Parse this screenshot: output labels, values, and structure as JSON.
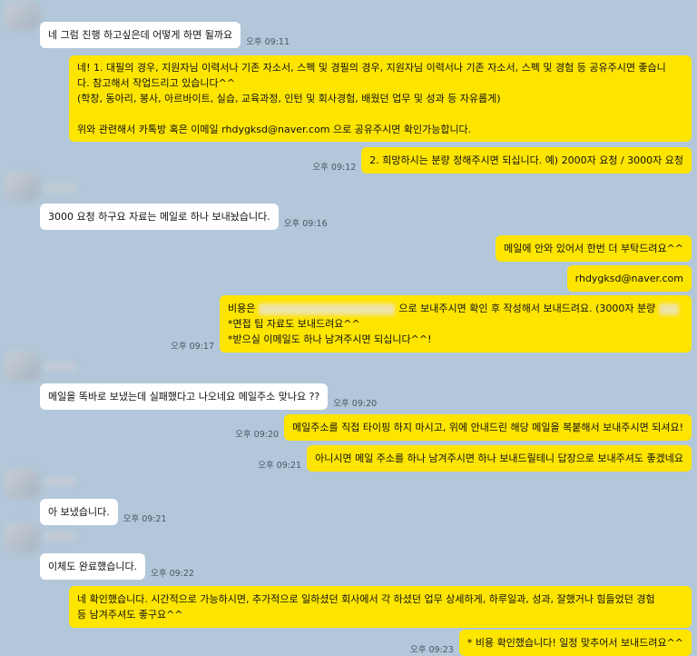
{
  "messages": [
    {
      "side": "in",
      "text": "네 그럼 진행 하고싶은데 어떻게 하면 될까요",
      "time": "오후 09:11"
    },
    {
      "side": "out",
      "text": "네! 1. 대필의 경우, 지원자님 이력서나 기존 자소서, 스펙 및 경필의 경우, 지원자님 이력서나 기존 자소서, 스펙 및 경험 등 공유주시면 좋습니\n다. 참고해서 작업드리고 있습니다^^\n(학창, 동아리, 봉사, 아르바이트, 실습, 교육과정, 인턴 및 회사경험, 배웠던 업무 및 성과 등 자유롭게)\n\n위와 관련해서 카톡방 혹은 이메일 rhdygksd@naver.com 으로 공유주시면 확인가능합니다.",
      "time": ""
    },
    {
      "side": "out",
      "text": "2. 희망하시는 분량 정해주시면 되십니다. 예) 2000자 요청 / 3000자 요청",
      "time": "오후 09:12"
    },
    {
      "side": "in",
      "text": "3000 요청 하구요 자료는 메일로 하나 보내놨습니다.",
      "time": "오후 09:16"
    },
    {
      "side": "out",
      "text": "메일에 안와 있어서 한번 더 부탁드려요^^",
      "time": ""
    },
    {
      "side": "out",
      "text": "rhdygksd@naver.com",
      "time": ""
    },
    {
      "side": "out",
      "line1_a": "비용은",
      "line1_b": "으로 보내주시면 확인 후 작성해서 보내드려요. (3000자 분량",
      "line2": "*면접 팁 자료도 보내드려요^^",
      "line3": "*받으실 이메일도 하나 남겨주시면 되십니다^^!",
      "time": "오후 09:17"
    },
    {
      "side": "in",
      "text": "메일을 똑바로 보냈는데 실패했다고 나오네요 메일주소 맞나요 ??",
      "time": "오후 09:20"
    },
    {
      "side": "out",
      "text": "메일주소를 직접 타이핑 하지 마시고, 위에 안내드린 해당 메일을 복붙해서 보내주시면 되셔요!",
      "time": "오후 09:20"
    },
    {
      "side": "out",
      "text": "아니시면 메일 주소를 하나 남겨주시면 하나 보내드릴테니 답장으로 보내주셔도 좋겠네요",
      "time": "오후 09:21"
    },
    {
      "side": "in",
      "text": "아 보냈습니다.",
      "time": "오후 09:21"
    },
    {
      "side": "in",
      "text": "이체도 완료했습니다.",
      "time": "오후 09:22"
    },
    {
      "side": "out",
      "text": "네 확인했습니다. 시간적으로 가능하시면, 추가적으로 일하셨던 회사에서 각 하셨던 업무 상세하게, 하루일과, 성과, 잘했거나 힘들었던 경험\n등 남겨주셔도 좋구요^^",
      "time": ""
    },
    {
      "side": "out",
      "text": "* 비용 확인했습니다! 일정 맞추어서 보내드려요^^",
      "time": "오후 09:23"
    }
  ]
}
